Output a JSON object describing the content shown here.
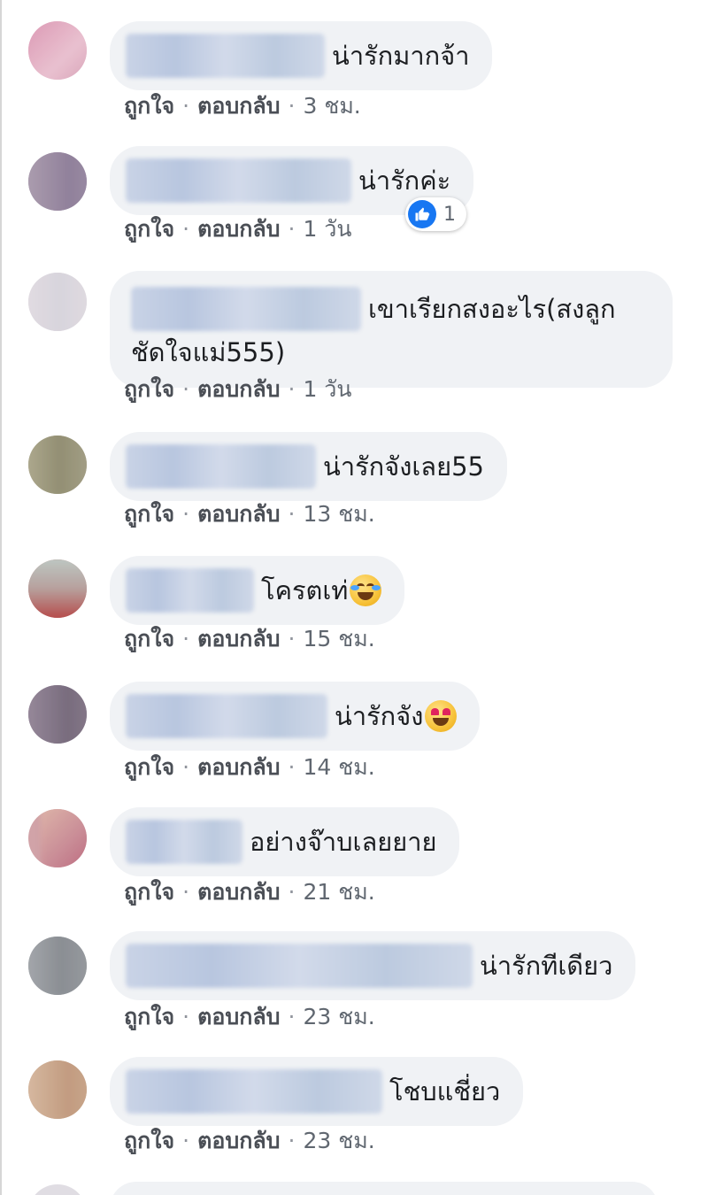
{
  "labels": {
    "like": "ถูกใจ",
    "reply": "ตอบกลับ",
    "separator": "·"
  },
  "colors": {
    "bubble_bg": "#f0f2f5",
    "meta_text": "#606770",
    "like_blue": "#1877f2"
  },
  "comments": [
    {
      "text": "น่ารักมากจ้า",
      "time": "3 ชม.",
      "avatar": "avatar-blurred-pink"
    },
    {
      "text": "น่ารักค่ะ",
      "time": "1 วัน",
      "avatar": "avatar-blurred-purple",
      "reaction": {
        "icon": "like-icon",
        "count": "1"
      }
    },
    {
      "text": "เขาเรียกสงอะไร(สงลูกชัดใจแม่555)",
      "time": "1 วัน",
      "avatar": "avatar-blurred-light"
    },
    {
      "text": "น่ารักจังเลย55",
      "time": "13 ชม.",
      "avatar": "avatar-blurred-olive"
    },
    {
      "text": "โครตเท่",
      "emoji": "laughing-tears-emoji",
      "time": "15 ชม.",
      "avatar": "avatar-blurred-red"
    },
    {
      "text": "น่ารักจัง",
      "emoji": "heart-eyes-emoji",
      "time": "14 ชม.",
      "avatar": "avatar-blurred-dark"
    },
    {
      "text": "อย่างจ๊าบเลยยาย",
      "time": "21 ชม.",
      "avatar": "avatar-blurred-rose"
    },
    {
      "text": "น่ารักทีเดียว",
      "time": "23 ชม.",
      "avatar": "avatar-blurred-gray"
    },
    {
      "text": "โชบแชี่ยว",
      "time": "23 ชม.",
      "avatar": "avatar-blurred-tan"
    }
  ]
}
